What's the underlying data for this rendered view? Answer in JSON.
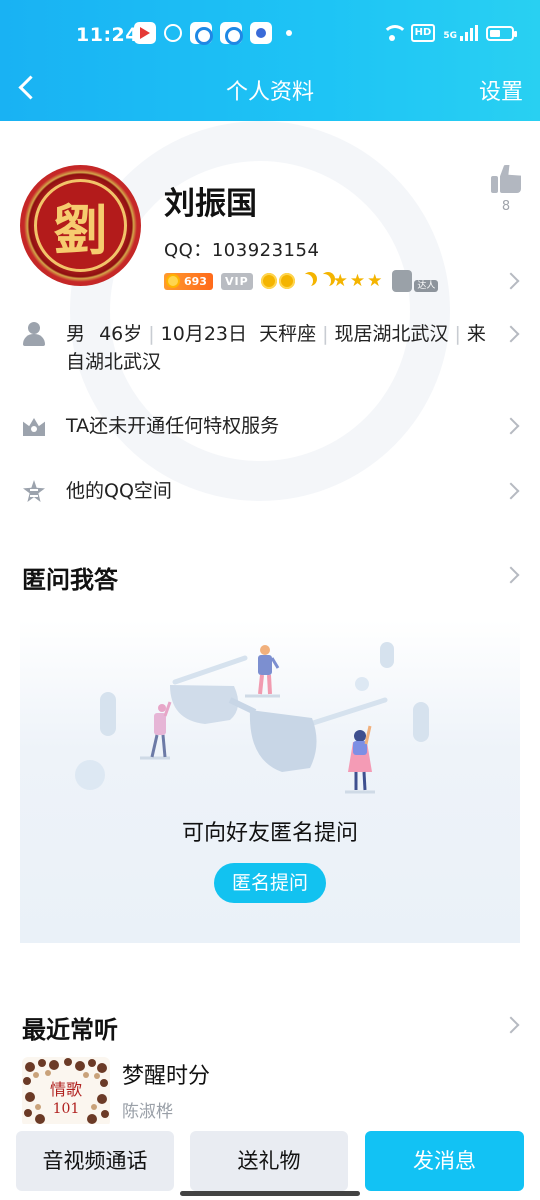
{
  "status_bar": {
    "time": "11:24",
    "hd_label": "HD",
    "network_label": "5G"
  },
  "header": {
    "title": "个人资料",
    "settings_label": "设置"
  },
  "profile": {
    "avatar_char": "劉",
    "name": "刘振国",
    "qq_label": "QQ：",
    "qq_number": "103923154",
    "coin_count": "693",
    "vip_label": "VIP",
    "talent_label": "达人",
    "likes": "8"
  },
  "info": {
    "gender": "男",
    "age": "46岁",
    "birthday": "10月23日",
    "zodiac": "天秤座",
    "residence": "现居湖北武汉",
    "hometown_prefix": "来",
    "hometown_rest": "自湖北武汉",
    "privilege": "TA还未开通任何特权服务",
    "qzone": "他的QQ空间"
  },
  "anonymous_qa": {
    "title": "匿问我答",
    "prompt": "可向好友匿名提问",
    "button": "匿名提问"
  },
  "recent_music": {
    "title": "最近常听",
    "album_text_top": "情歌",
    "album_text_bottom": "101",
    "song": "梦醒时分",
    "artist": "陈淑桦"
  },
  "actions": {
    "call": "音视频通话",
    "gift": "送礼物",
    "message": "发消息"
  },
  "colors": {
    "accent": "#12c2f4",
    "header_start": "#19b2f3",
    "icon_grey": "#9ca3ad"
  }
}
